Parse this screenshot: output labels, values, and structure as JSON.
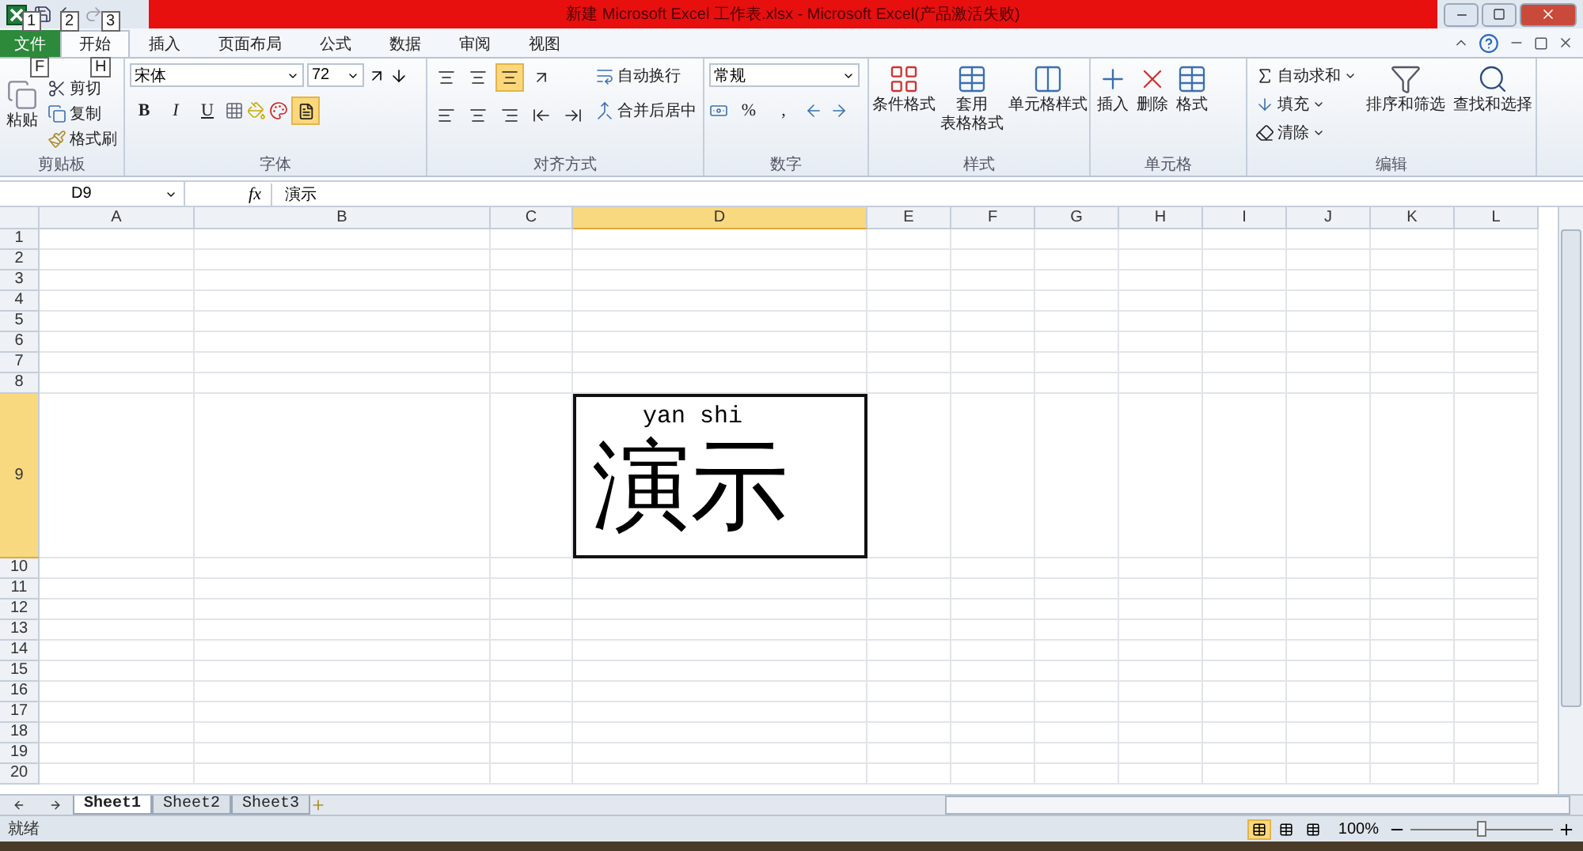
{
  "title_bar": {
    "title": "新建 Microsoft Excel 工作表.xlsx  -  Microsoft Excel(产品激活失败)",
    "key_tips": [
      "1",
      "2",
      "3"
    ]
  },
  "ribbon_tabs": [
    {
      "label": "文件",
      "selected": false,
      "key_tip": "F"
    },
    {
      "label": "开始",
      "selected": true,
      "key_tip": "H"
    },
    {
      "label": "插入",
      "selected": false
    },
    {
      "label": "页面布局",
      "selected": false
    },
    {
      "label": "公式",
      "selected": false
    },
    {
      "label": "数据",
      "selected": false
    },
    {
      "label": "审阅",
      "selected": false
    },
    {
      "label": "视图",
      "selected": false
    }
  ],
  "clipboard": {
    "label": "剪贴板",
    "paste": "粘贴",
    "cut": "剪切",
    "copy": "复制",
    "format_painter": "格式刷"
  },
  "font": {
    "label": "字体",
    "font_name": "宋体",
    "font_size": "72",
    "bold": "B",
    "italic": "I",
    "underline": "U",
    "phonetic_guide_on": true
  },
  "alignment": {
    "label": "对齐方式",
    "bottom_align_on": true,
    "wrap_text": "自动换行",
    "merge_center": "合并后居中"
  },
  "number": {
    "label": "数字",
    "format": "常规",
    "percent": "%",
    "comma": ","
  },
  "styles": {
    "label": "样式",
    "conditional": "条件格式",
    "table_format": [
      "套用",
      "表格格式"
    ],
    "cell_styles": "单元格样式"
  },
  "cells": {
    "label": "单元格",
    "insert": "插入",
    "delete": "删除",
    "format": "格式"
  },
  "editing": {
    "label": "编辑",
    "autosum": "自动求和",
    "fill": "填充",
    "clear": "清除",
    "sort_filter": "排序和筛选",
    "find_select": "查找和选择"
  },
  "formula_bar": {
    "name_box": "D9",
    "fx": "fx",
    "value": "演示"
  },
  "columns": [
    {
      "label": "A",
      "selected": false
    },
    {
      "label": "B",
      "selected": false
    },
    {
      "label": "C",
      "selected": false
    },
    {
      "label": "D",
      "selected": true
    },
    {
      "label": "E",
      "selected": false
    },
    {
      "label": "F",
      "selected": false
    },
    {
      "label": "G",
      "selected": false
    },
    {
      "label": "H",
      "selected": false
    },
    {
      "label": "I",
      "selected": false
    },
    {
      "label": "J",
      "selected": false
    },
    {
      "label": "K",
      "selected": false
    },
    {
      "label": "L",
      "selected": false
    }
  ],
  "rows": [
    {
      "label": "1",
      "selected": false,
      "kind": "normal"
    },
    {
      "label": "2",
      "selected": false,
      "kind": "normal"
    },
    {
      "label": "3",
      "selected": false,
      "kind": "normal"
    },
    {
      "label": "4",
      "selected": false,
      "kind": "normal"
    },
    {
      "label": "5",
      "selected": false,
      "kind": "normal"
    },
    {
      "label": "6",
      "selected": false,
      "kind": "normal"
    },
    {
      "label": "7",
      "selected": false,
      "kind": "normal"
    },
    {
      "label": "8",
      "selected": false,
      "kind": "normal"
    },
    {
      "label": "9",
      "selected": true,
      "kind": "tall"
    },
    {
      "label": "10",
      "selected": false,
      "kind": "normal"
    },
    {
      "label": "11",
      "selected": false,
      "kind": "normal"
    },
    {
      "label": "12",
      "selected": false,
      "kind": "normal"
    },
    {
      "label": "13",
      "selected": false,
      "kind": "normal"
    },
    {
      "label": "14",
      "selected": false,
      "kind": "normal"
    },
    {
      "label": "15",
      "selected": false,
      "kind": "normal"
    },
    {
      "label": "16",
      "selected": false,
      "kind": "normal"
    },
    {
      "label": "17",
      "selected": false,
      "kind": "normal"
    },
    {
      "label": "18",
      "selected": false,
      "kind": "normal"
    },
    {
      "label": "19",
      "selected": false,
      "kind": "normal"
    },
    {
      "label": "20",
      "selected": false,
      "kind": "normal"
    }
  ],
  "active_cell": {
    "phonetic": "yan shi",
    "value": "演示"
  },
  "sheet_tabs": [
    {
      "label": "Sheet1",
      "selected": true
    },
    {
      "label": "Sheet2",
      "selected": false
    },
    {
      "label": "Sheet3",
      "selected": false
    }
  ],
  "status_bar": {
    "status": "就绪",
    "zoom": "100%",
    "zoom_slider": {
      "level": 0.5
    },
    "views": [
      {
        "selected": true
      },
      {
        "selected": false
      },
      {
        "selected": false
      }
    ]
  }
}
